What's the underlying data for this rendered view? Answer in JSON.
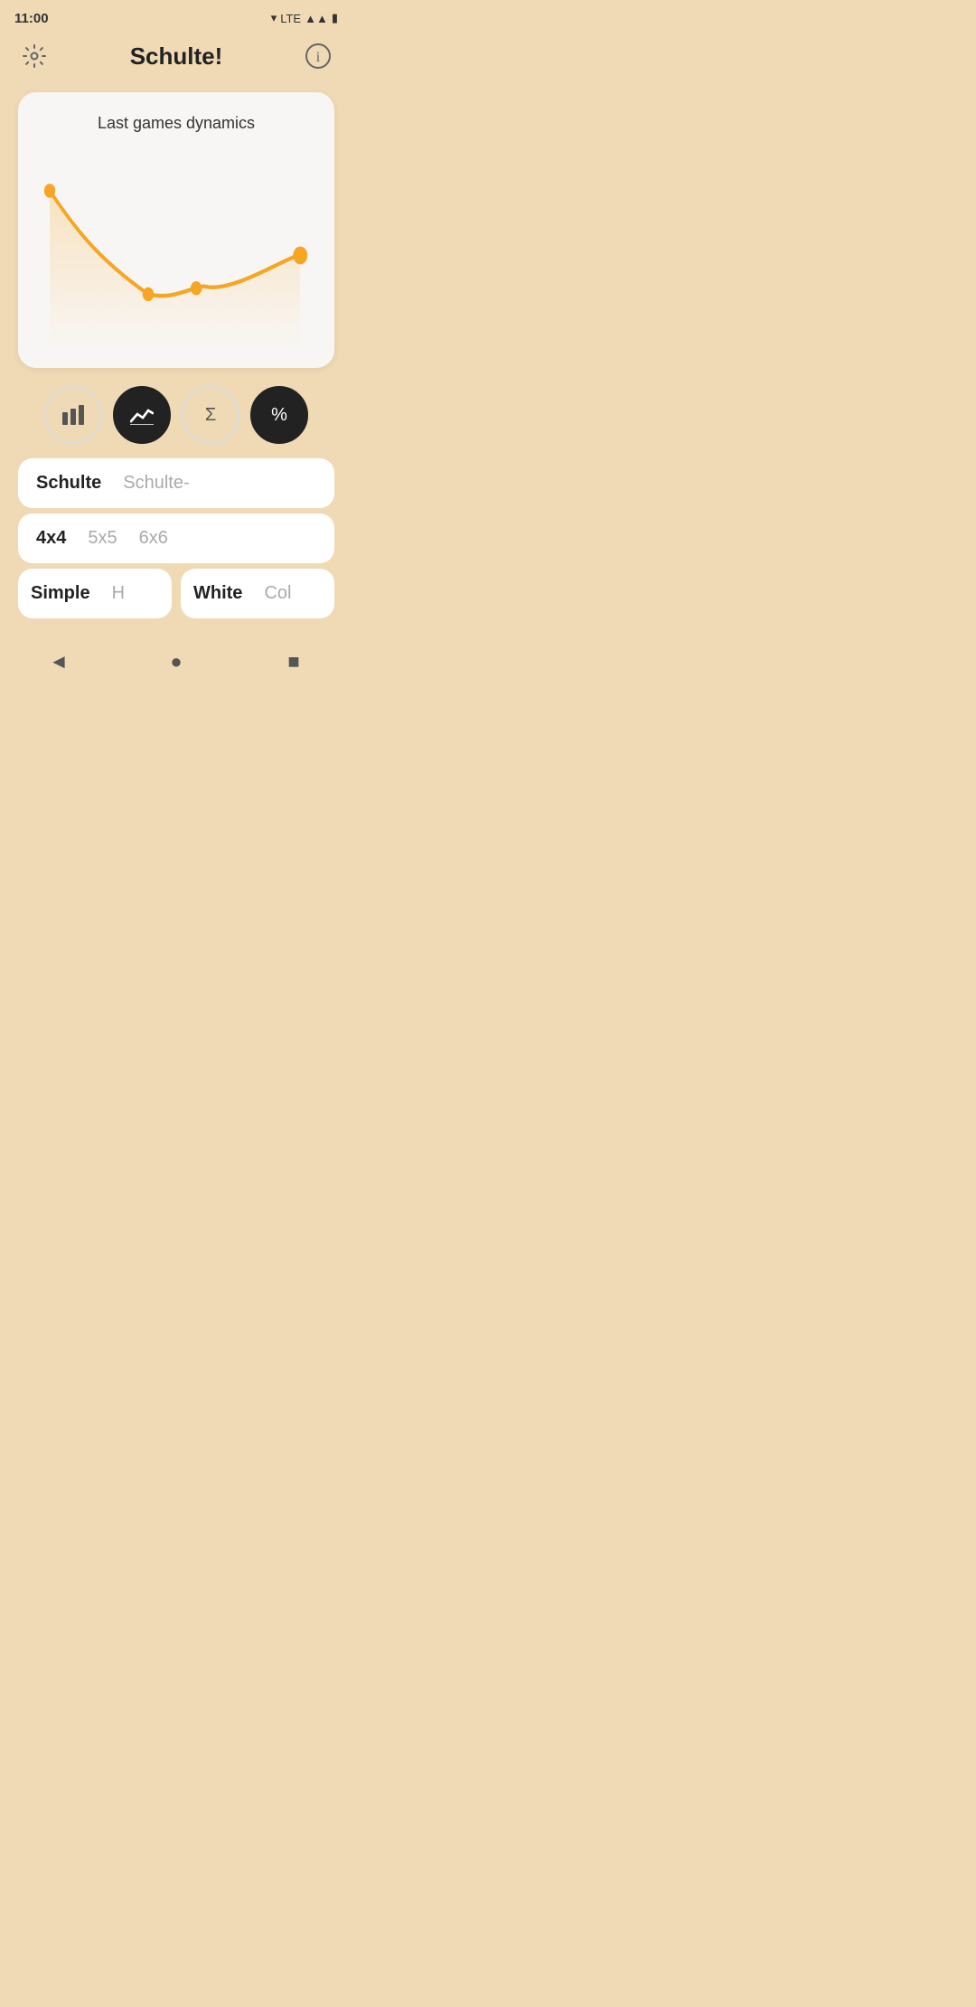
{
  "status": {
    "time": "11:00",
    "icons": "▾ LTE▲▲ 🔋"
  },
  "header": {
    "title": "Schulte!",
    "settings_icon": "⚙",
    "info_icon": "ⓘ"
  },
  "chart": {
    "title": "Last games dynamics",
    "accent_color": "#F5A623",
    "data_points": [
      {
        "x": 0.05,
        "y": 0.2
      },
      {
        "x": 0.2,
        "y": 0.55
      },
      {
        "x": 0.4,
        "y": 0.72
      },
      {
        "x": 0.55,
        "y": 0.7
      },
      {
        "x": 0.7,
        "y": 0.68
      },
      {
        "x": 0.9,
        "y": 0.52
      }
    ]
  },
  "tabs": [
    {
      "id": "bar",
      "icon": "▐▐▐",
      "label": "bar-chart",
      "active": false
    },
    {
      "id": "line",
      "icon": "~",
      "label": "line-chart",
      "active": true
    },
    {
      "id": "sigma",
      "icon": "Σ",
      "label": "sigma",
      "active": false
    },
    {
      "id": "percent",
      "icon": "%",
      "label": "percent",
      "active": true
    }
  ],
  "selectors": {
    "game_type": {
      "selected": "Schulte",
      "options": [
        "Schulte",
        "Schulte-"
      ]
    },
    "grid_size": {
      "selected": "4x4",
      "options": [
        "4x4",
        "5x5",
        "6x6"
      ]
    },
    "mode": {
      "selected": "Simple",
      "options": [
        "Simple",
        "H"
      ]
    },
    "color": {
      "selected": "White",
      "options": [
        "White",
        "Col"
      ]
    }
  },
  "nav": {
    "back_icon": "◄",
    "home_icon": "●",
    "square_icon": "■"
  }
}
